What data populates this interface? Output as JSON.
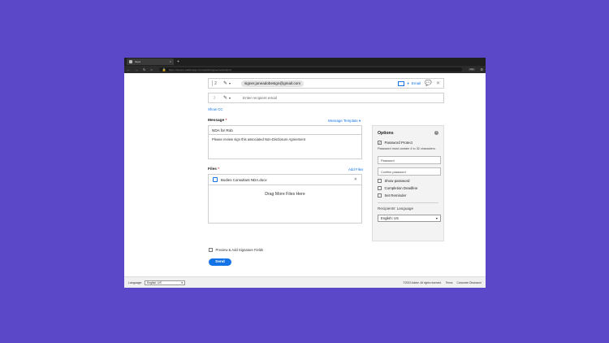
{
  "browser": {
    "tab_title": "Send",
    "tab_close": "×",
    "new_tab": "+",
    "url": "https://secure.adobesign.com/public/agreements/send",
    "extension": "1.0x"
  },
  "recipients": [
    {
      "number": "2",
      "email": "signer.janeadobesign@gmail.com",
      "delivery": "Email"
    },
    {
      "number": "3",
      "placeholder": "Enter recipient email"
    }
  ],
  "show_cc": "Show CC",
  "message": {
    "label": "Message",
    "required": "*",
    "template_link": "Message Template",
    "title": "NDA for Rob",
    "body": "Please review sign this associated Non-Disclosure Agreement"
  },
  "files": {
    "label": "Files",
    "required": "*",
    "add_link": "Add Files",
    "items": [
      {
        "name": "Bodies Consultant NDA.docx"
      }
    ],
    "drag_text": "Drag More Files Here"
  },
  "options": {
    "title": "Options",
    "help": "?",
    "password_protect": {
      "label": "Password Protect",
      "checked": true
    },
    "hint": "Password must contain 4 to 32 characters.",
    "password_placeholder": "Password",
    "confirm_placeholder": "Confirm password",
    "show_password": "Show password",
    "completion_deadline": "Completion Deadline",
    "set_reminder": "Set Reminder",
    "recipients_language_label": "Recipients' Language",
    "recipients_language_value": "English: US"
  },
  "preview_label": "Preview & Add Signature Fields",
  "send_label": "Send",
  "footer": {
    "language_label": "Language:",
    "language_value": "English: US",
    "copyright": "©2023 Adobe. All rights reserved.",
    "terms": "Terms",
    "consumer": "Consumer Disclosure"
  },
  "colors": {
    "accent": "#1473e6",
    "background": "#5a48c9"
  }
}
